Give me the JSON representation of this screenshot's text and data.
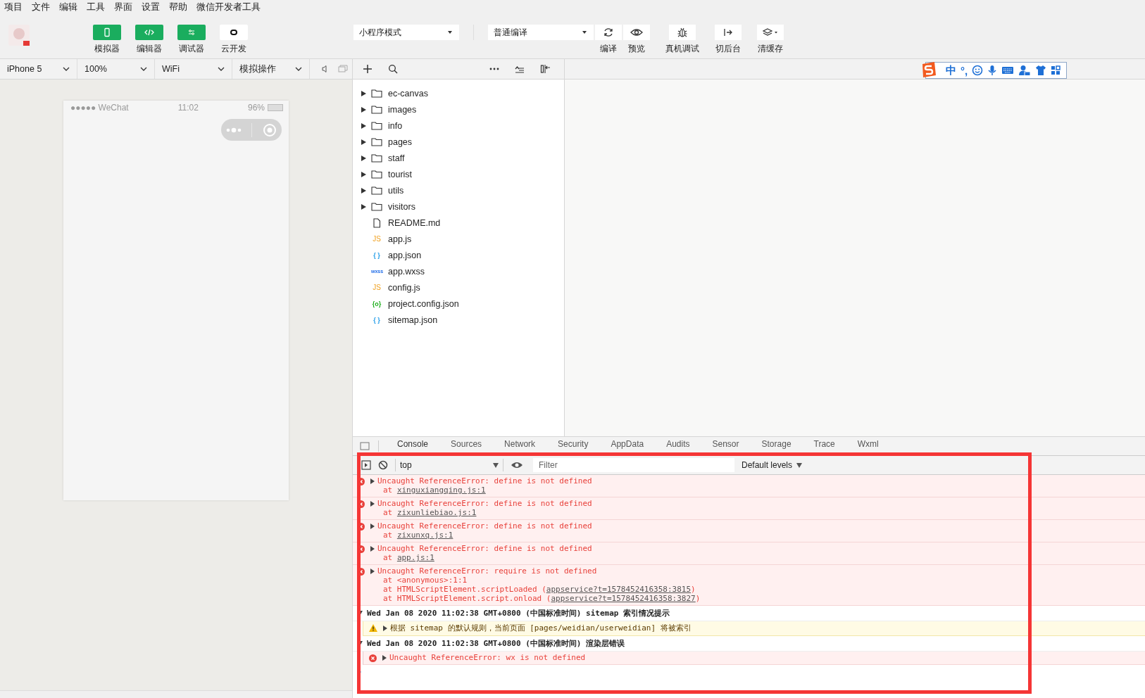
{
  "menu": [
    "项目",
    "文件",
    "编辑",
    "工具",
    "界面",
    "设置",
    "帮助",
    "微信开发者工具"
  ],
  "toolbar": {
    "modes": [
      {
        "label": "模拟器",
        "kind": "green"
      },
      {
        "label": "编辑器",
        "kind": "green"
      },
      {
        "label": "调试器",
        "kind": "green"
      },
      {
        "label": "云开发",
        "kind": "white"
      }
    ],
    "mode_select": "小程序模式",
    "compile_select": "普通编译",
    "actions": [
      {
        "label": "编译",
        "kind": "refresh"
      },
      {
        "label": "预览",
        "kind": "eye"
      },
      {
        "label": "真机调试",
        "kind": "bug"
      },
      {
        "label": "切后台",
        "kind": "switch"
      },
      {
        "label": "清缓存",
        "kind": "layers"
      }
    ]
  },
  "device_bar": [
    "iPhone 5",
    "100%",
    "WiFi",
    "模拟操作"
  ],
  "simulator": {
    "carrier": "●●●●● WeChat",
    "time": "11:02",
    "battery": "96%"
  },
  "ime_bar": {
    "labels": [
      "中",
      "°,"
    ]
  },
  "file_tree": [
    {
      "name": "ec-canvas",
      "kind": "folder",
      "expanded": false
    },
    {
      "name": "images",
      "kind": "folder",
      "expanded": false
    },
    {
      "name": "info",
      "kind": "folder",
      "expanded": false
    },
    {
      "name": "pages",
      "kind": "folder",
      "expanded": false
    },
    {
      "name": "staff",
      "kind": "folder",
      "expanded": false
    },
    {
      "name": "tourist",
      "kind": "folder",
      "expanded": false
    },
    {
      "name": "utils",
      "kind": "folder",
      "expanded": false
    },
    {
      "name": "visitors",
      "kind": "folder",
      "expanded": false
    },
    {
      "name": "README.md",
      "kind": "file"
    },
    {
      "name": "app.js",
      "kind": "js",
      "icon_text": "JS"
    },
    {
      "name": "app.json",
      "kind": "json",
      "icon_text": "{ }"
    },
    {
      "name": "app.wxss",
      "kind": "wxss",
      "icon_text": "wxss"
    },
    {
      "name": "config.js",
      "kind": "js",
      "icon_text": "JS"
    },
    {
      "name": "project.config.json",
      "kind": "config",
      "icon_text": "{o}"
    },
    {
      "name": "sitemap.json",
      "kind": "json",
      "icon_text": "{ }"
    }
  ],
  "devtools": {
    "tabs": [
      {
        "label": "Console",
        "selected": true
      },
      {
        "label": "Sources",
        "selected": false
      },
      {
        "label": "Network",
        "selected": false
      },
      {
        "label": "Security",
        "selected": false
      },
      {
        "label": "AppData",
        "selected": false
      },
      {
        "label": "Audits",
        "selected": false
      },
      {
        "label": "Sensor",
        "selected": false
      },
      {
        "label": "Storage",
        "selected": false
      },
      {
        "label": "Trace",
        "selected": false
      },
      {
        "label": "Wxml",
        "selected": false
      }
    ],
    "context": "top",
    "filter_placeholder": "Filter",
    "levels": "Default levels",
    "logs": [
      {
        "kind": "error",
        "message": "Uncaught ReferenceError: define is not defined",
        "stack": [
          {
            "text": "at ",
            "link": "xinguxiangqing.js:1"
          }
        ]
      },
      {
        "kind": "error",
        "message": "Uncaught ReferenceError: define is not defined",
        "stack": [
          {
            "text": "at ",
            "link": "zixunliebiao.js:1"
          }
        ]
      },
      {
        "kind": "error",
        "message": "Uncaught ReferenceError: define is not defined",
        "stack": [
          {
            "text": "at ",
            "link": "zixunxq.js:1"
          }
        ]
      },
      {
        "kind": "error",
        "message": "Uncaught ReferenceError: define is not defined",
        "stack": [
          {
            "text": "at ",
            "link": "app.js:1"
          }
        ]
      },
      {
        "kind": "error",
        "message": "Uncaught ReferenceError: require is not defined",
        "stack": [
          {
            "text": "at <anonymous>:1:1"
          },
          {
            "text": "at HTMLScriptElement.scriptLoaded (",
            "link": "appservice?t=1578452416358:3815",
            "suffix": ")"
          },
          {
            "text": "at HTMLScriptElement.script.onload (",
            "link": "appservice?t=1578452416358:3827",
            "suffix": ")"
          }
        ]
      },
      {
        "kind": "group",
        "message": "Wed Jan 08 2020 11:02:38 GMT+0800 (中国标准时间) sitemap 索引情况提示",
        "expanded": true
      },
      {
        "kind": "warning",
        "message": "根据 sitemap 的默认规则，当前页面 [pages/weidian/userweidian] 将被索引",
        "nested": true
      },
      {
        "kind": "group",
        "message": "Wed Jan 08 2020 11:02:38 GMT+0800 (中国标准时间) 渲染层错误",
        "expanded": true
      },
      {
        "kind": "error",
        "message": "Uncaught ReferenceError: wx is not defined",
        "nested": true
      }
    ]
  }
}
